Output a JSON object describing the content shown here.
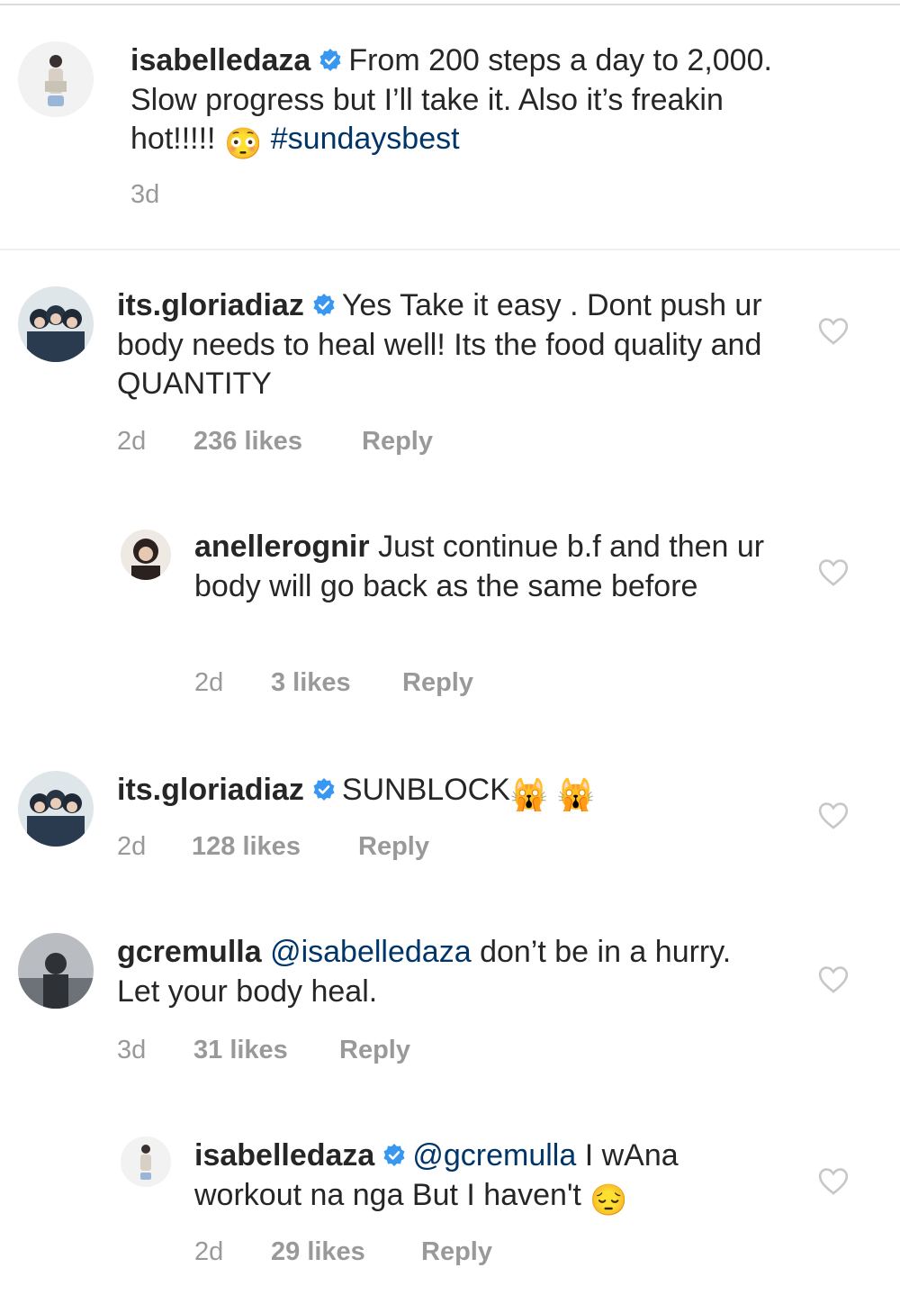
{
  "post": {
    "username": "isabelledaza",
    "text_a": "From 200 steps a day to 2,000. Slow progress but I’ll take it. Also it’s freakin hot!!!!!",
    "emoji": "😳",
    "hashtag": "#sundaysbest",
    "time": "3d"
  },
  "comments": [
    {
      "username": "its.gloriadiaz",
      "verified": true,
      "text": "Yes Take it easy . Dont push ur body needs to heal well! Its the food quality and QUANTITY",
      "time": "2d",
      "likes": "236 likes",
      "reply": "Reply"
    },
    {
      "username": "anellerognir",
      "verified": false,
      "text": "Just continue b.f and then ur body will go back as the same before",
      "time": "2d",
      "likes": "3 likes",
      "reply": "Reply"
    },
    {
      "username": "its.gloriadiaz",
      "verified": true,
      "text": "SUNBLOCK",
      "emoji": "🙀 🙀",
      "time": "2d",
      "likes": "128 likes",
      "reply": "Reply"
    },
    {
      "username": "gcremulla",
      "verified": false,
      "mention": "@isabelledaza",
      "text": "don’t be in a hurry. Let your body heal.",
      "time": "3d",
      "likes": "31 likes",
      "reply": "Reply"
    },
    {
      "username": "isabelledaza",
      "verified": true,
      "mention": "@gcremulla",
      "text": "I wAna workout na nga But I haven't",
      "emoji": "😔",
      "time": "2d",
      "likes": "29 likes",
      "reply": "Reply"
    }
  ],
  "icons": {
    "verified": "verified-badge-icon",
    "like": "heart-outline-icon"
  },
  "colors": {
    "verified_blue": "#3897f0",
    "link": "#003569",
    "meta_gray": "#999999",
    "heart_gray": "#c7c7c7"
  }
}
